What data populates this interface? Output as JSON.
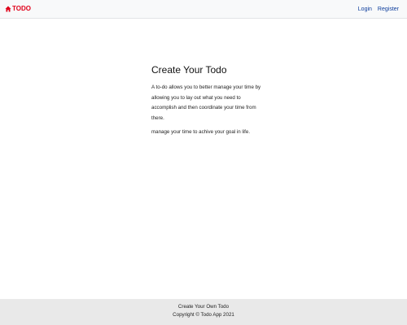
{
  "navbar": {
    "brand_label": "TODO",
    "brand_icon": "home-icon",
    "links": [
      {
        "label": "Login"
      },
      {
        "label": "Register"
      }
    ]
  },
  "main": {
    "title": "Create Your Todo",
    "paragraphs": [
      "A to-do allows you to better manage your time by allowing you to lay out what you need to accomplish and then coordinate your time from there.",
      "manage your time to achive your goal in life."
    ]
  },
  "footer": {
    "line1": "Create Your Own Todo",
    "line2": "Copyright © Todo App 2021"
  },
  "colors": {
    "brand": "#e0001a",
    "link": "#0d3d9c",
    "navbar_bg": "#f8f9fa",
    "footer_bg": "#e9e9e9"
  }
}
